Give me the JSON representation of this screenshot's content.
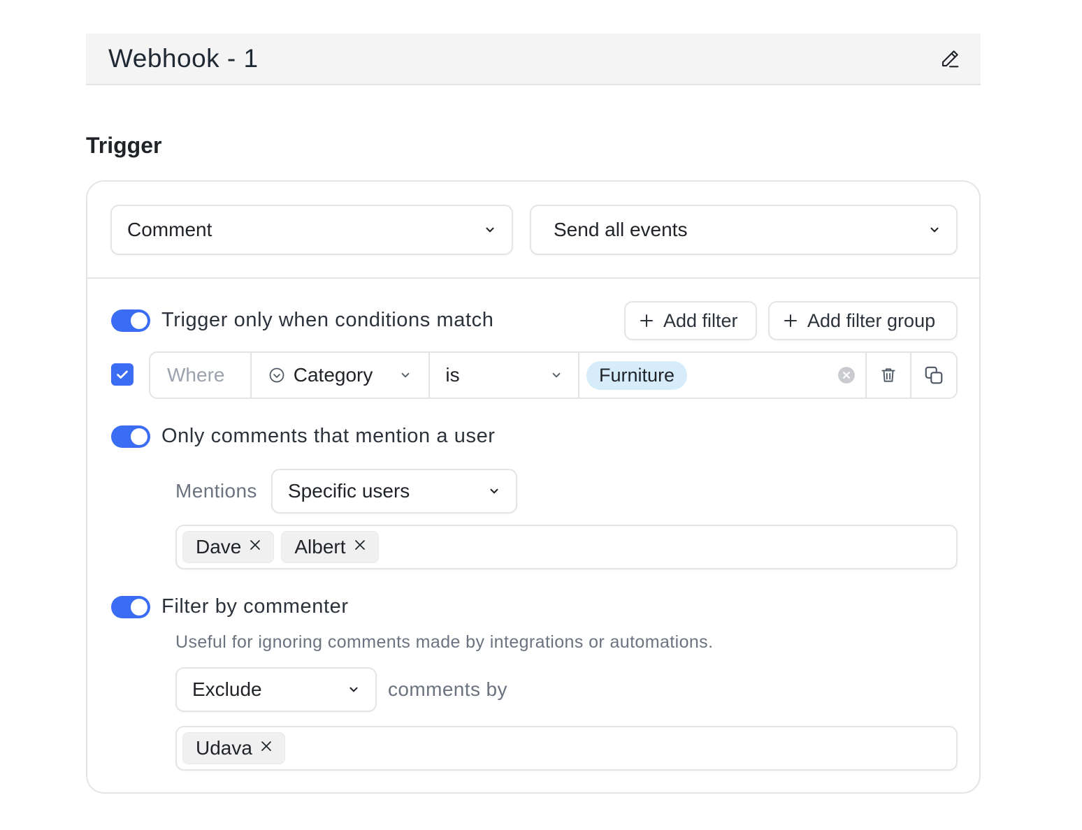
{
  "webhook": {
    "title": "Webhook - 1"
  },
  "trigger": {
    "section_label": "Trigger",
    "event_select": {
      "value": "Comment"
    },
    "mode_select": {
      "value": "Send all events"
    },
    "conditions": {
      "toggle_label": "Trigger only when conditions match",
      "enabled": true,
      "add_filter_label": "Add filter",
      "add_filter_group_label": "Add filter group",
      "filter": {
        "checked": true,
        "where_label": "Where",
        "field": "Category",
        "operator": "is",
        "value": "Furniture"
      }
    },
    "mentions": {
      "toggle_label": "Only comments that mention a user",
      "enabled": true,
      "mentions_label": "Mentions",
      "mentions_select": "Specific users",
      "users": [
        "Dave",
        "Albert"
      ]
    },
    "commenter": {
      "toggle_label": "Filter by commenter",
      "enabled": true,
      "description": "Useful for ignoring comments made by integrations or automations.",
      "mode_select": "Exclude",
      "comments_by_label": "comments by",
      "users": [
        "Udava"
      ]
    }
  },
  "colors": {
    "accent": "#3b6cf4",
    "chip_blue": "#d7ecfb",
    "border": "#e4e4e7"
  },
  "icons": [
    "edit-icon",
    "chevron-down-icon",
    "plus-icon",
    "check-icon",
    "circle-check-icon",
    "clear-icon",
    "trash-icon",
    "copy-icon",
    "close-icon"
  ]
}
